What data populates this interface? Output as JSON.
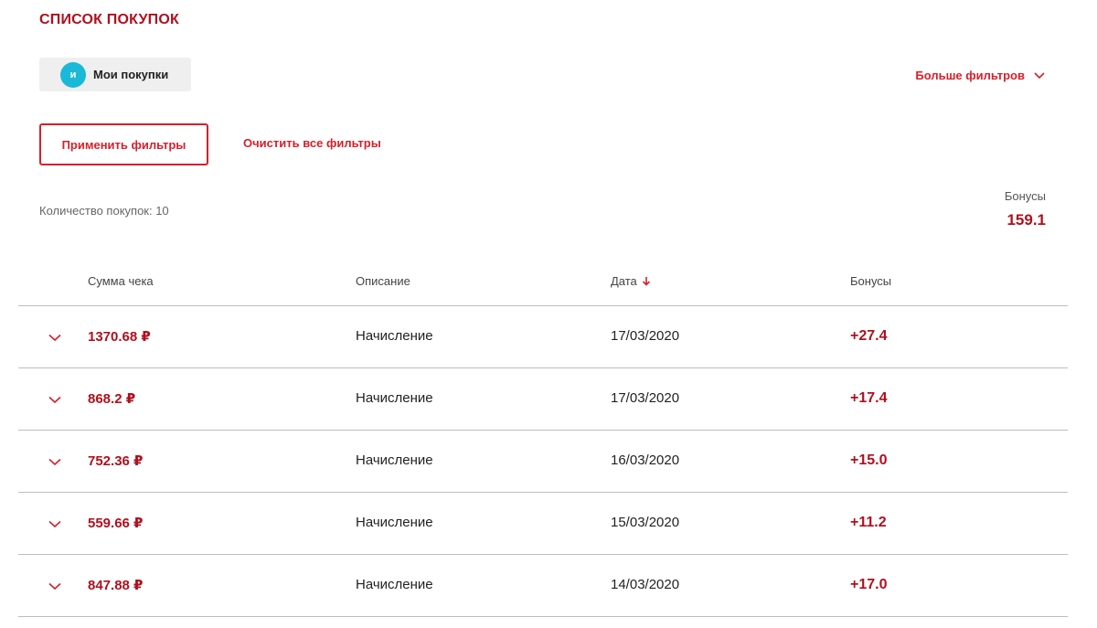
{
  "header": {
    "title": "СПИСОК ПОКУПОК"
  },
  "filters": {
    "chip_avatar": "и",
    "chip_label": "Мои покупки",
    "more_filters_label": "Больше фильтров",
    "apply_label": "Применить фильтры",
    "clear_label": "Очистить все фильтры"
  },
  "summary": {
    "count_text": "Количество покупок: 10",
    "bonus_label": "Бонусы",
    "bonus_value": "159.1"
  },
  "table": {
    "columns": {
      "sum": "Сумма чека",
      "description": "Описание",
      "date": "Дата",
      "bonus": "Бонусы"
    },
    "sort": {
      "column": "date",
      "direction": "desc"
    },
    "rows": [
      {
        "sum": "1370.68 ₽",
        "description": "Начисление",
        "date": "17/03/2020",
        "bonus": "+27.4"
      },
      {
        "sum": "868.2 ₽",
        "description": "Начисление",
        "date": "17/03/2020",
        "bonus": "+17.4"
      },
      {
        "sum": "752.36 ₽",
        "description": "Начисление",
        "date": "16/03/2020",
        "bonus": "+15.0"
      },
      {
        "sum": "559.66 ₽",
        "description": "Начисление",
        "date": "15/03/2020",
        "bonus": "+11.2"
      },
      {
        "sum": "847.88 ₽",
        "description": "Начисление",
        "date": "14/03/2020",
        "bonus": "+17.0"
      }
    ]
  },
  "colors": {
    "accent": "#d81f2a",
    "accent_dark": "#b0101e",
    "avatar": "#19b9d7",
    "chip_bg": "#efefef"
  },
  "icons": {
    "more_filters": "chevron-down-icon",
    "sort": "arrow-down-icon",
    "row_expand": "chevron-down-icon"
  }
}
